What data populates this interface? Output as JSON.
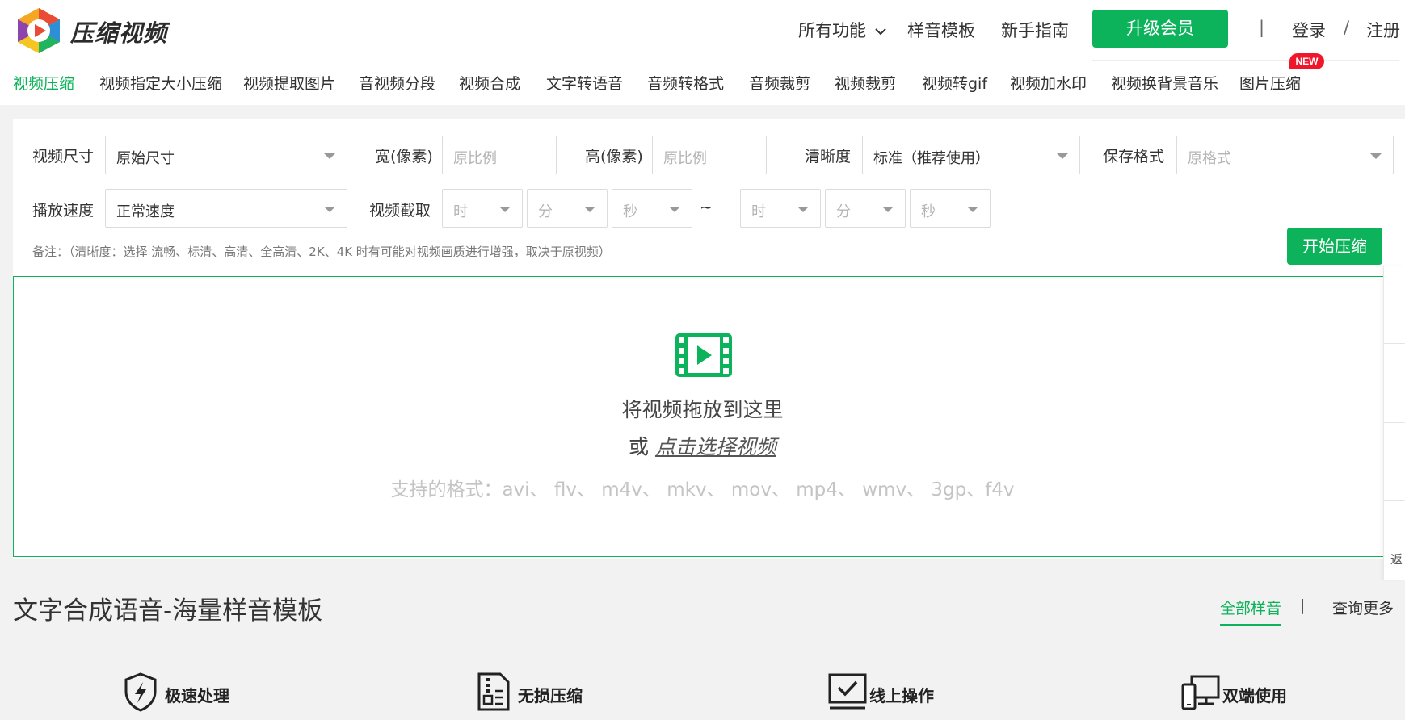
{
  "header": {
    "brand": "压缩视频",
    "nav": {
      "all_features": "所有功能",
      "voice_templates": "样音模板",
      "beginner_guide": "新手指南",
      "upgrade": "升级会员",
      "divider": "|",
      "login": "登录",
      "slash": "/",
      "register": "注册"
    },
    "badge_new": "NEW",
    "categories": [
      "视频压缩",
      "视频指定大小压缩",
      "视频提取图片",
      "音视频分段",
      "视频合成",
      "文字转语音",
      "音频转格式",
      "音频裁剪",
      "视频裁剪",
      "视频转gif",
      "视频加水印",
      "视频换背景音乐",
      "图片压缩"
    ]
  },
  "settings": {
    "video_size": {
      "label": "视频尺寸",
      "value": "原始尺寸"
    },
    "width": {
      "label": "宽(像素)",
      "placeholder": "原比例"
    },
    "height": {
      "label": "高(像素)",
      "placeholder": "原比例"
    },
    "clarity": {
      "label": "清晰度",
      "value": "标准（推荐使用）"
    },
    "format": {
      "label": "保存格式",
      "placeholder": "原格式"
    },
    "speed": {
      "label": "播放速度",
      "value": "正常速度"
    },
    "clip": {
      "label": "视频截取",
      "start_hour": "时",
      "start_min": "分",
      "start_sec": "秒",
      "tilde": "~",
      "end_hour": "时",
      "end_min": "分",
      "end_sec": "秒"
    },
    "note": "备注：（清晰度：选择 流畅、标清、高清、全高清、2K、4K 时有可能对视频画质进行增强，取决于原视频）",
    "start_button": "开始压缩"
  },
  "dropzone": {
    "main": "将视频拖放到这里",
    "or": "或",
    "select_link": "点击选择视频",
    "formats": "支持的格式：avi、 flv、 m4v、 mkv、 mov、 mp4、 wmv、 3gp、f4v"
  },
  "side_rail": {
    "back_text": "返"
  },
  "section": {
    "title": "文字合成语音-海量样音模板",
    "tab_all": "全部样音",
    "divider": "|",
    "tab_more": "查询更多"
  },
  "features": [
    {
      "label": "极速处理",
      "icon": "shield-bolt-icon"
    },
    {
      "label": "无损压缩",
      "icon": "zip-file-icon"
    },
    {
      "label": "线上操作",
      "icon": "monitor-check-icon"
    },
    {
      "label": "双端使用",
      "icon": "phone-desktop-icon"
    }
  ],
  "colors": {
    "accent": "#0db35b",
    "badge": "#f0172c"
  }
}
